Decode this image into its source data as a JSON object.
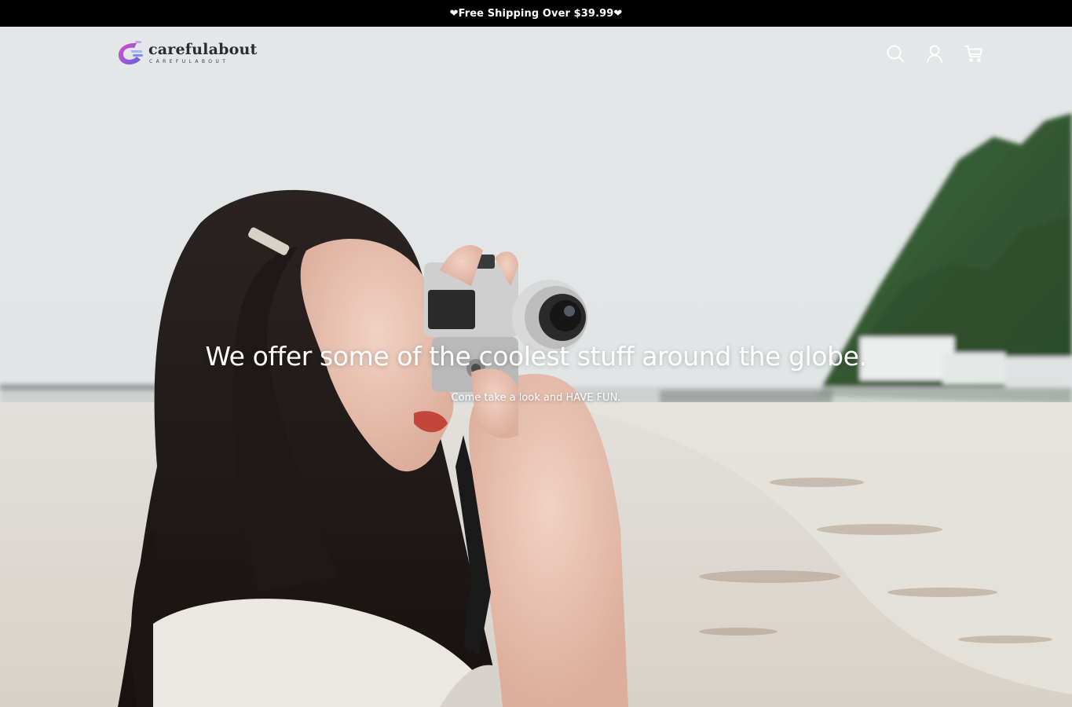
{
  "announcement": {
    "text": "❤Free Shipping Over $39.99❤"
  },
  "header": {
    "logo": {
      "name": "carefulabout",
      "tagline": "CAREFULABOUT"
    },
    "icons": [
      "search-icon",
      "account-icon",
      "cart-icon"
    ]
  },
  "hero": {
    "title": "We offer some of the coolest stuff around the globe.",
    "subtitle": "Come take a look and HAVE FUN."
  },
  "colors": {
    "announcement_bg": "#000000",
    "announcement_text": "#ffffff",
    "hero_text": "#ffffff",
    "logo_gradient_start": "#e14cc5",
    "logo_gradient_end": "#5a63e8"
  }
}
